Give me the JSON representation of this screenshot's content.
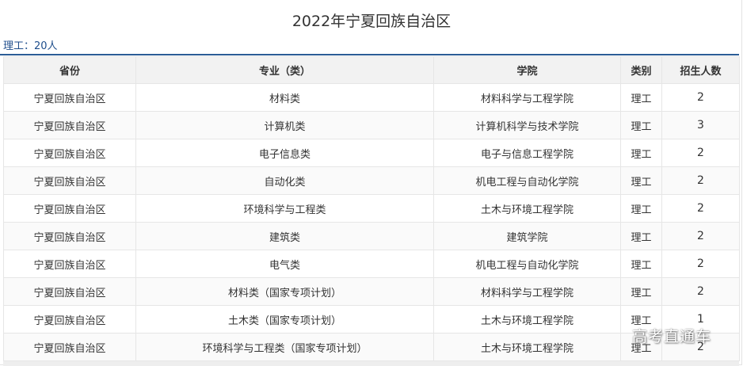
{
  "page": {
    "title": "2022年宁夏回族自治区"
  },
  "summary": {
    "label": "理工：",
    "count": "20人"
  },
  "table": {
    "headers": [
      "省份",
      "专业（类）",
      "学院",
      "类别",
      "招生人数"
    ],
    "rows": [
      [
        "宁夏回族自治区",
        "材料类",
        "材料科学与工程学院",
        "理工",
        "2"
      ],
      [
        "宁夏回族自治区",
        "计算机类",
        "计算机科学与技术学院",
        "理工",
        "3"
      ],
      [
        "宁夏回族自治区",
        "电子信息类",
        "电子与信息工程学院",
        "理工",
        "2"
      ],
      [
        "宁夏回族自治区",
        "自动化类",
        "机电工程与自动化学院",
        "理工",
        "2"
      ],
      [
        "宁夏回族自治区",
        "环境科学与工程类",
        "土木与环境工程学院",
        "理工",
        "2"
      ],
      [
        "宁夏回族自治区",
        "建筑类",
        "建筑学院",
        "理工",
        "2"
      ],
      [
        "宁夏回族自治区",
        "电气类",
        "机电工程与自动化学院",
        "理工",
        "2"
      ],
      [
        "宁夏回族自治区",
        "材料类（国家专项计划）",
        "材料科学与工程学院",
        "理工",
        "2"
      ],
      [
        "宁夏回族自治区",
        "土木类（国家专项计划）",
        "土木与环境工程学院",
        "理工",
        "1"
      ],
      [
        "宁夏回族自治区",
        "环境科学与工程类（国家专项计划）",
        "土木与环境工程学院",
        "理工",
        "2"
      ]
    ]
  },
  "watermark": {
    "text": "高考直通车"
  }
}
